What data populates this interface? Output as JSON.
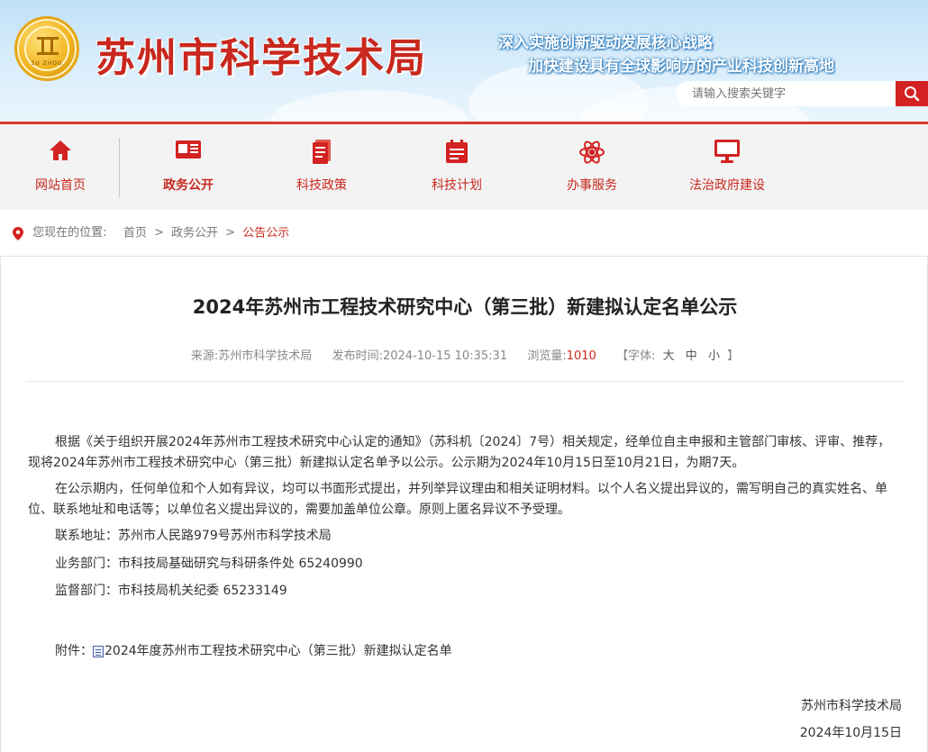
{
  "header": {
    "site_title": "苏州市科学技术局",
    "logo_text": "SU ZHOU",
    "slogan_line1": "深入实施创新驱动发展核心战略",
    "slogan_line2": "加快建设具有全球影响力的产业科技创新高地",
    "search_placeholder": "请输入搜索关键字",
    "accent_color": "#c8281e"
  },
  "nav": {
    "items": [
      {
        "label": "网站首页",
        "icon": "home-icon"
      },
      {
        "label": "政务公开",
        "icon": "newspaper-icon",
        "active": true
      },
      {
        "label": "科技政策",
        "icon": "document-icon"
      },
      {
        "label": "科技计划",
        "icon": "calendar-icon"
      },
      {
        "label": "办事服务",
        "icon": "atom-icon"
      },
      {
        "label": "法治政府建设",
        "icon": "monitor-icon"
      }
    ]
  },
  "breadcrumb": {
    "prefix": "您现在的位置:",
    "items": [
      "首页",
      "政务公开",
      "公告公示"
    ],
    "separator": ">"
  },
  "article": {
    "title": "2024年苏州市工程技术研究中心（第三批）新建拟认定名单公示",
    "meta": {
      "source_label": "来源:",
      "source": "苏州市科学技术局",
      "published_label": "发布时间:",
      "published": "2024-10-15 10:35:31",
      "views_label": "浏览量:",
      "views": "1010",
      "font_label": "【字体:",
      "font_sizes": [
        "大",
        "中",
        "小"
      ],
      "font_close": "】"
    },
    "paragraph1": "根据《关于组织开展2024年苏州市工程技术研究中心认定的通知》（苏科机〔2024〕7号）相关规定，经单位自主申报和主管部门审核、评审、推荐，现将2024年苏州市工程技术研究中心（第三批）新建拟认定名单予以公示。公示期为2024年10月15日至10月21日，为期7天。",
    "paragraph2": "在公示期内，任何单位和个人如有异议，均可以书面形式提出，并列举异议理由和相关证明材料。以个人名义提出异议的，需写明自己的真实姓名、单位、联系地址和电话等；以单位名义提出异议的，需要加盖单位公章。原则上匿名异议不予受理。",
    "contact_address": "联系地址：苏州市人民路979号苏州市科学技术局",
    "business_dept": "业务部门：市科技局基础研究与科研条件处  65240990",
    "supervision_dept": "监督部门：市科技局机关纪委  65233149",
    "attachment_label": "附件：",
    "attachment_name": "2024年度苏州市工程技术研究中心（第三批）新建拟认定名单",
    "signature_org": "苏州市科学技术局",
    "signature_date": "2024年10月15日"
  }
}
